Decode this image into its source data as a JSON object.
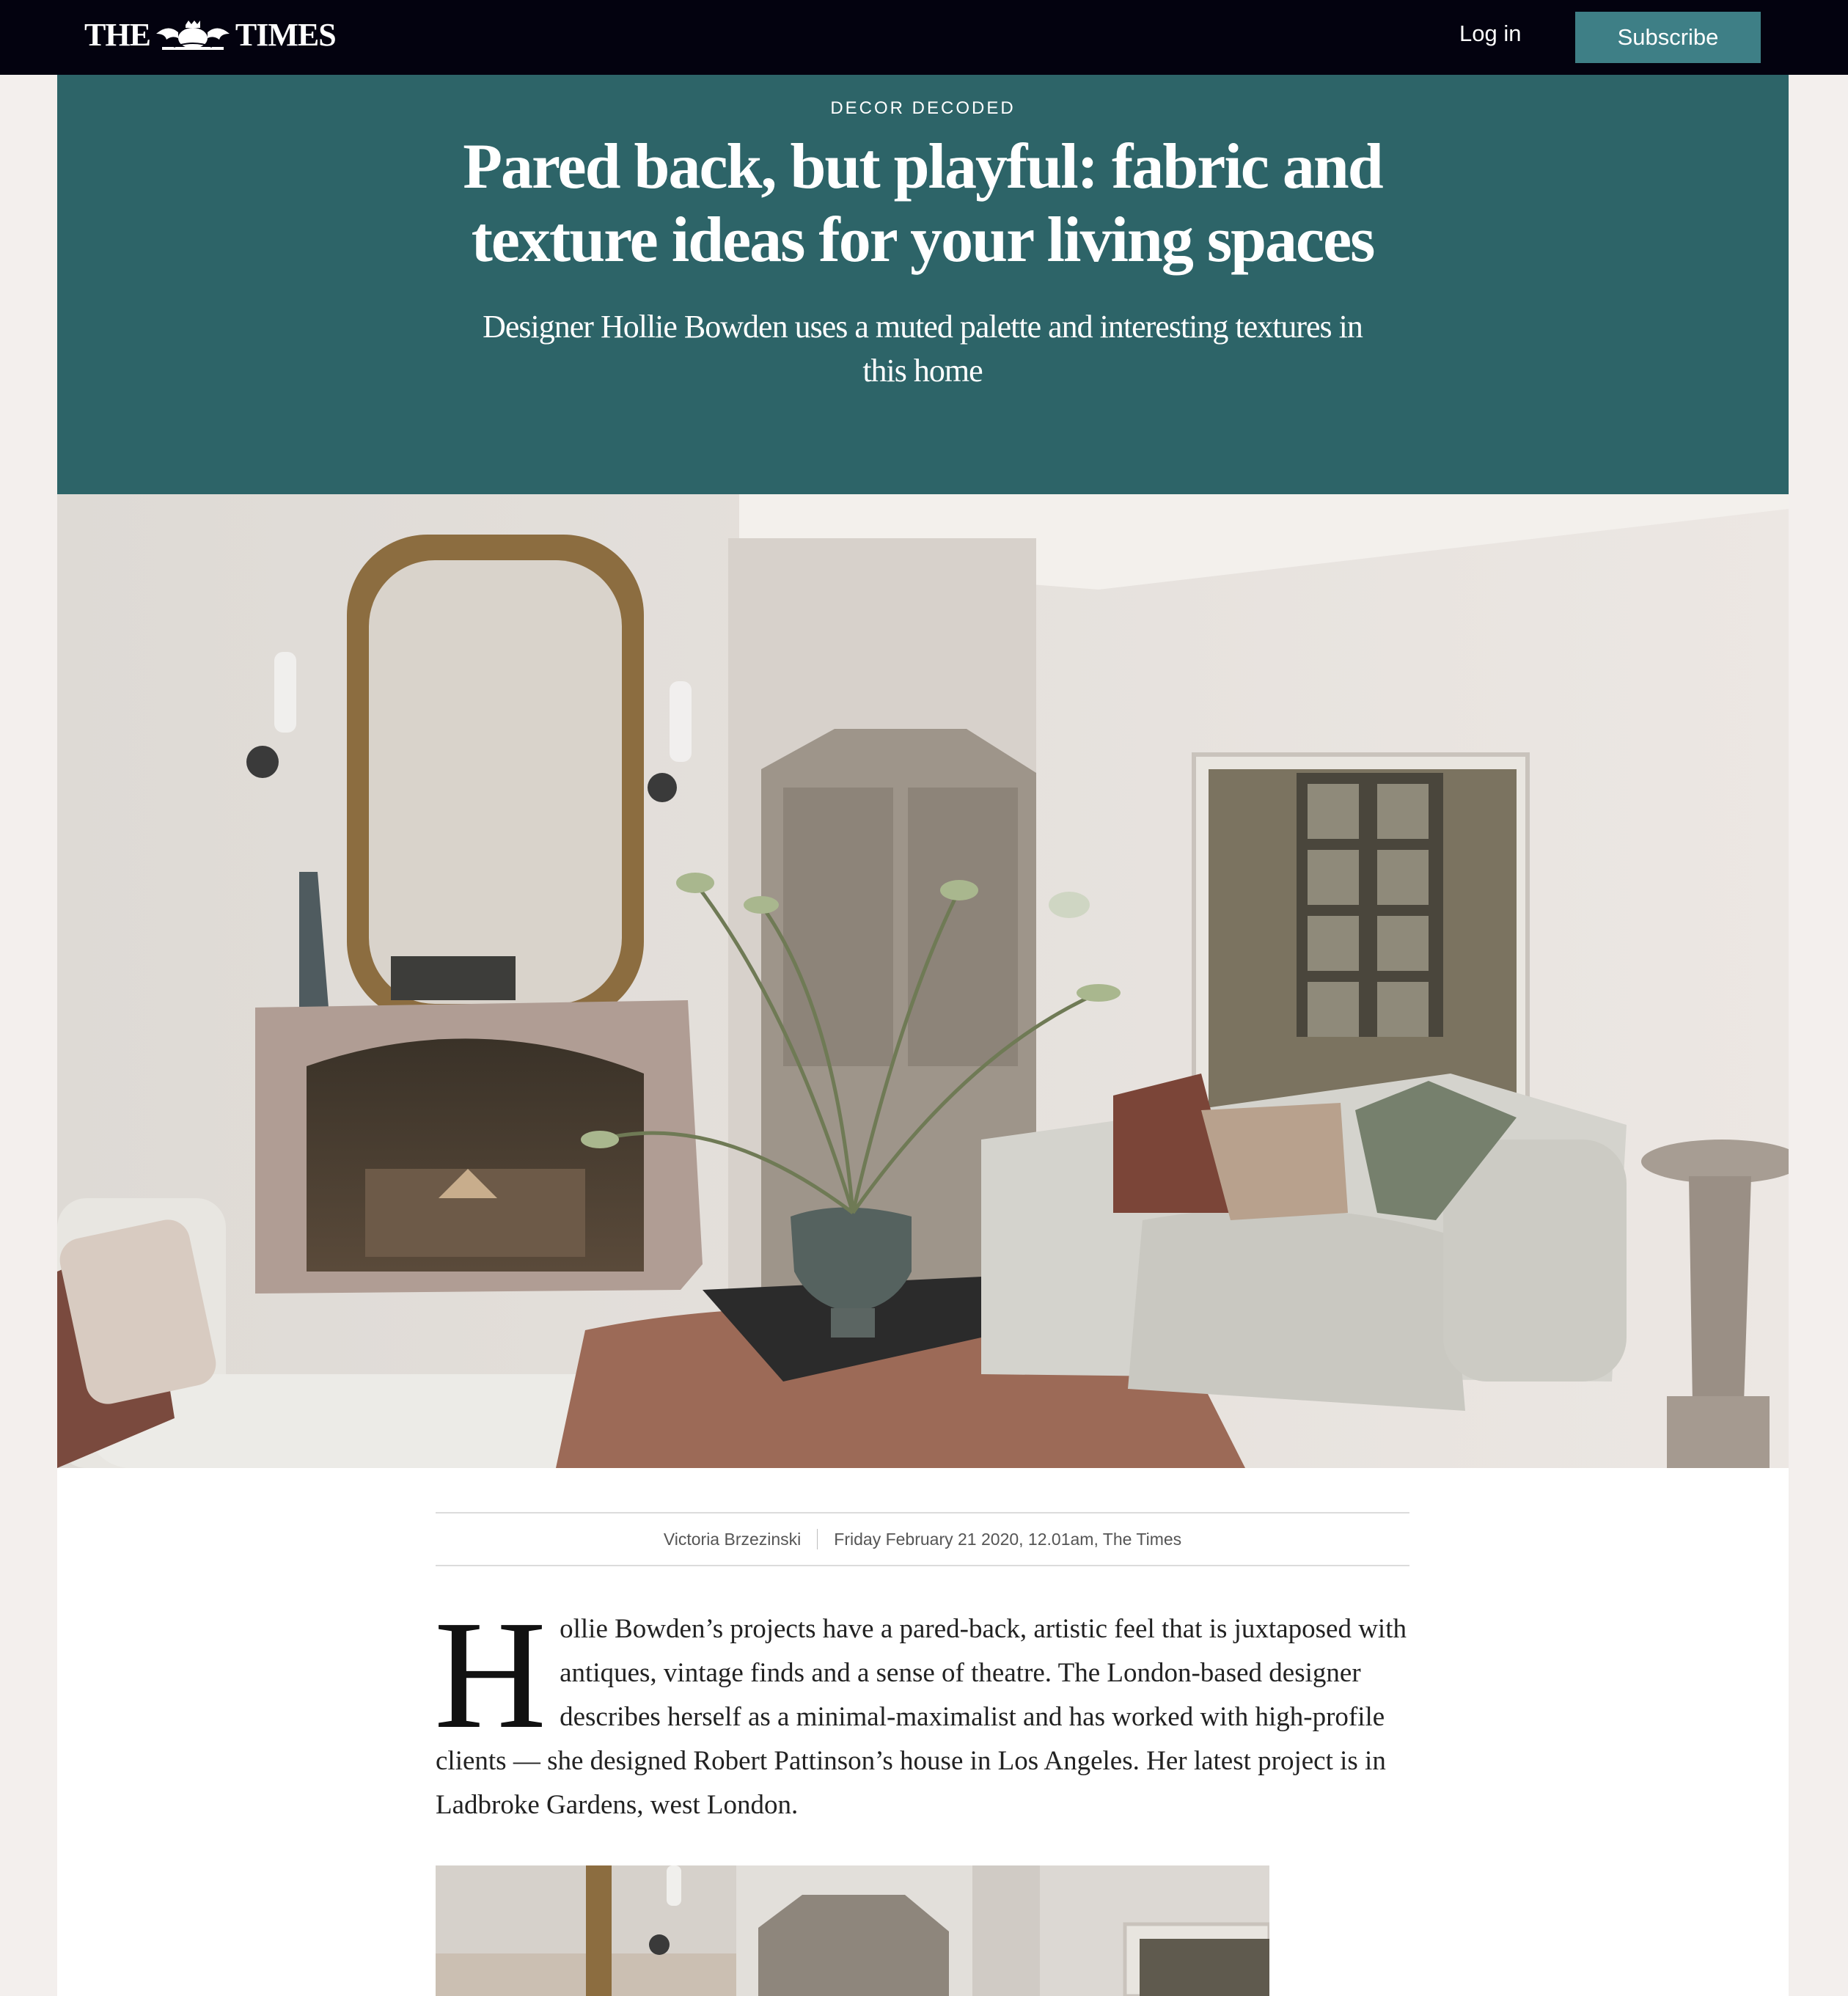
{
  "brand": {
    "left": "THE",
    "right": "TIMES",
    "crest": "royal-crest-icon"
  },
  "nav": {
    "login": "Log in",
    "subscribe": "Subscribe"
  },
  "article": {
    "kicker": "DECOR DECODED",
    "headline": "Pared back, but playful: fabric and texture ideas for your living spaces",
    "standfirst": "Designer Hollie Bowden uses a muted palette and interesting textures in this home",
    "author": "Victoria Brzezinski",
    "date": "Friday February 21 2020, 12.01am, The Times",
    "dropcap": "H",
    "paragraph": "ollie Bowden’s projects have a pared-back, artistic feel that is juxtaposed with antiques, vintage finds and a sense of theatre. The London-based designer describes herself as a minimal-maximalist and has worked with high-profile clients — she designed Robert Pattinson’s house in Los Angeles. Her latest project is in Ladbroke Gardens, west London."
  },
  "colors": {
    "topbar": "#03020f",
    "header_teal": "#2d6468",
    "subscribe_teal": "#3e7f86",
    "page_bg": "#f3efed"
  }
}
